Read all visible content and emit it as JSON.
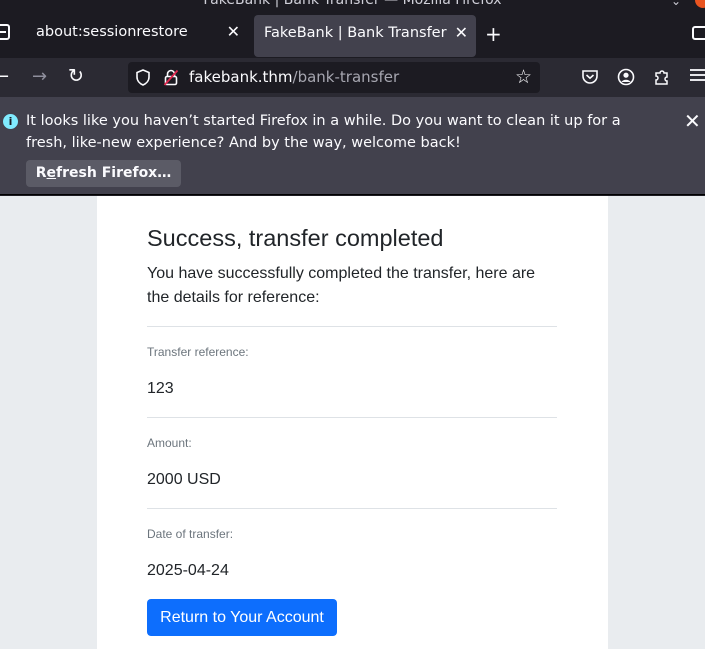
{
  "window": {
    "title": "FakeBank | Bank Transfer — Mozilla Firefox"
  },
  "tabs": [
    {
      "label": "about:sessionrestore",
      "active": false
    },
    {
      "label": "FakeBank | Bank Transfer",
      "active": true
    }
  ],
  "toolbar": {
    "url_host": "fakebank.thm",
    "url_path": "/bank-transfer"
  },
  "icons": {
    "tab_list": "tab-list-icon",
    "close": "close-icon",
    "new_tab": "plus-icon",
    "back": "back-arrow-icon",
    "forward": "forward-arrow-icon",
    "reload": "reload-icon",
    "shield": "shield-icon",
    "lock": "insecure-lock-icon",
    "bookmark": "star-icon",
    "pocket": "pocket-icon",
    "account": "account-icon",
    "extensions": "extensions-icon",
    "menu": "hamburger-menu-icon",
    "info": "info-icon"
  },
  "notification": {
    "message": "It looks like you haven’t started Firefox in a while. Do you want to clean it up for a fresh, like-new experience? And by the way, welcome back!",
    "refresh_label_pre": "R",
    "refresh_label_accesskey": "e",
    "refresh_label_post": "fresh Firefox…"
  },
  "page": {
    "heading": "Success, transfer completed",
    "lead": "You have successfully completed the transfer, here are the details for reference:",
    "details": [
      {
        "label": "Transfer reference:",
        "value": "123"
      },
      {
        "label": "Amount:",
        "value": "2000 USD"
      },
      {
        "label": "Date of transfer:",
        "value": "2025-04-24"
      }
    ],
    "return_button": "Return to Your Account"
  },
  "colors": {
    "browser_bg": "#1c1b22",
    "toolbar_bg": "#2b2a33",
    "notification_bg": "#42414d",
    "page_bg": "#e9ecef",
    "primary": "#0d6efd",
    "close_dot": "#e95420"
  }
}
